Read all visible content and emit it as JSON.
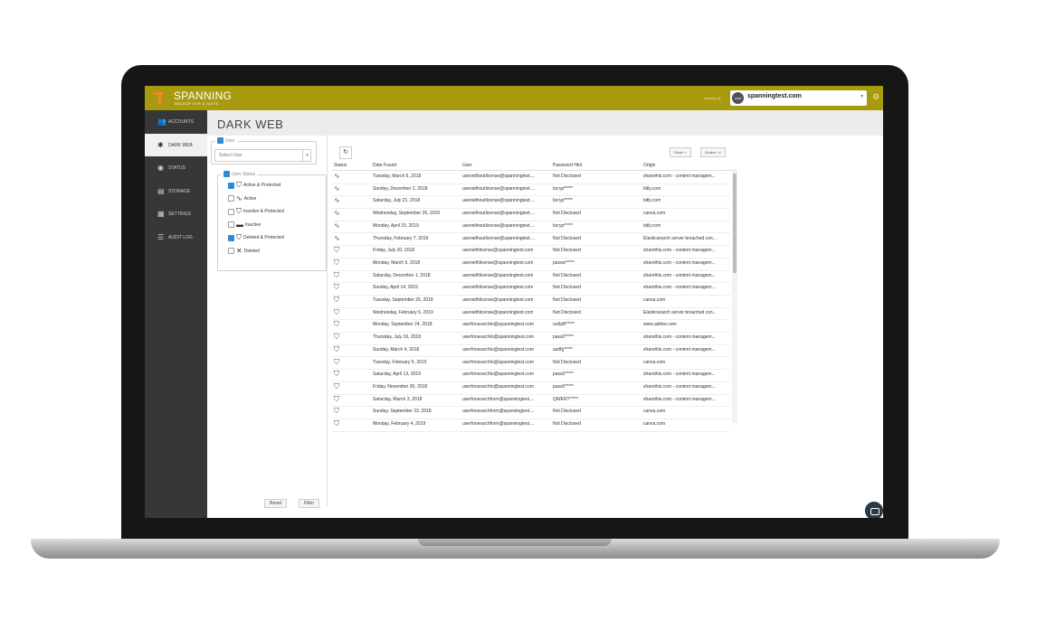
{
  "app": {
    "brand": "SPANNING",
    "brand_sub": "BACKUP FOR G SUITE",
    "view_as": "viewing as",
    "domain": "spanningtest.com",
    "domain_avatar": "com"
  },
  "sidebar": {
    "items": [
      {
        "label": "ACCOUNTS",
        "icon": "users-icon",
        "glyph": "👥",
        "active": false
      },
      {
        "label": "DARK WEB",
        "icon": "spider-icon",
        "glyph": "✱",
        "active": true
      },
      {
        "label": "STATUS",
        "icon": "status-icon",
        "glyph": "◉",
        "active": false
      },
      {
        "label": "STORAGE",
        "icon": "storage-icon",
        "glyph": "▤",
        "active": false
      },
      {
        "label": "SETTINGS",
        "icon": "settings-icon",
        "glyph": "▦",
        "active": false
      },
      {
        "label": "AUDIT LOG",
        "icon": "list-icon",
        "glyph": "☰",
        "active": false
      }
    ]
  },
  "page": {
    "title": "DARK WEB"
  },
  "filters": {
    "user_legend": "User",
    "user_placeholder": "Select User",
    "status_legend": "User Status",
    "statuses": [
      {
        "label": "Active & Protected",
        "checked": true,
        "glyph": "⛉"
      },
      {
        "label": "Active",
        "checked": false,
        "glyph": "∿"
      },
      {
        "label": "Inactive & Protected",
        "checked": false,
        "glyph": "⛉"
      },
      {
        "label": "Inactive",
        "checked": false,
        "glyph": "▬"
      },
      {
        "label": "Deleted & Protected",
        "checked": true,
        "glyph": "⛉"
      },
      {
        "label": "Deleted",
        "checked": false,
        "glyph": "✕"
      }
    ],
    "reset_label": "Reset",
    "filter_label": "Filter"
  },
  "toolbar": {
    "refresh_glyph": "↻",
    "order_prev": "Order <",
    "order_next": "Orders >>"
  },
  "table": {
    "headers": [
      "Status",
      "Date Found",
      "User",
      "Password Hint",
      "Origin"
    ],
    "rows": [
      {
        "status": "active",
        "date": "Tuesday, March 6, 2018",
        "user": "userwithoutlicense@spanningtest....",
        "hint": "Not Disclosed",
        "origin": "sharethis.com - content managem..."
      },
      {
        "status": "active",
        "date": "Sunday, December 2, 2018",
        "user": "userwithoutlicense@spanningtest....",
        "hint": "bcryp*****",
        "origin": "bitly.com"
      },
      {
        "status": "active",
        "date": "Saturday, July 21, 2018",
        "user": "userwithoutlicense@spanningtest....",
        "hint": "bcryp*****",
        "origin": "bitly.com"
      },
      {
        "status": "active",
        "date": "Wednesday, September 26, 2018",
        "user": "userwithoutlicense@spanningtest....",
        "hint": "Not Disclosed",
        "origin": "canva.com"
      },
      {
        "status": "active",
        "date": "Monday, April 15, 2019",
        "user": "userwithoutlicense@spanningtest....",
        "hint": "bcryp*****",
        "origin": "bitly.com"
      },
      {
        "status": "active",
        "date": "Thursday, February 7, 2019",
        "user": "userwithoutlicense@spanningtest....",
        "hint": "Not Disclosed",
        "origin": "Elasticsearch server breached con..."
      },
      {
        "status": "protected",
        "date": "Friday, July 20, 2018",
        "user": "userwithlicense@spanningtest.com",
        "hint": "Not Disclosed",
        "origin": "sharethis.com - content managem..."
      },
      {
        "status": "protected",
        "date": "Monday, March 5, 2018",
        "user": "userwithlicense@spanningtest.com",
        "hint": "passw*****",
        "origin": "sharethis.com - content managem..."
      },
      {
        "status": "protected",
        "date": "Saturday, December 1, 2018",
        "user": "userwithlicense@spanningtest.com",
        "hint": "Not Disclosed",
        "origin": "sharethis.com - content managem..."
      },
      {
        "status": "protected",
        "date": "Sunday, April 14, 2019",
        "user": "userwithlicense@spanningtest.com",
        "hint": "Not Disclosed",
        "origin": "sharethis.com - content managem..."
      },
      {
        "status": "protected",
        "date": "Tuesday, September 25, 2018",
        "user": "userwithlicense@spanningtest.com",
        "hint": "Not Disclosed",
        "origin": "canva.com"
      },
      {
        "status": "protected",
        "date": "Wednesday, February 6, 2019",
        "user": "userwithlicense@spanningtest.com",
        "hint": "Not Disclosed",
        "origin": "Elasticsearch server breached con..."
      },
      {
        "status": "protected",
        "date": "Monday, September 24, 2018",
        "user": "userforsearchto@spanningtest.com",
        "hint": "ou9pB*****",
        "origin": "www.adobe.com"
      },
      {
        "status": "protected",
        "date": "Thursday, July 19, 2018",
        "user": "userforsearchto@spanningtest.com",
        "hint": "pass0*****",
        "origin": "sharethis.com - content managem..."
      },
      {
        "status": "protected",
        "date": "Sunday, March 4, 2018",
        "user": "userforsearchto@spanningtest.com",
        "hint": "asdfg*****",
        "origin": "sharethis.com - content managem..."
      },
      {
        "status": "protected",
        "date": "Tuesday, February 5, 2019",
        "user": "userforsearchto@spanningtest.com",
        "hint": "Not Disclosed",
        "origin": "canva.com"
      },
      {
        "status": "protected",
        "date": "Saturday, April 13, 2019",
        "user": "userforsearchto@spanningtest.com",
        "hint": "pass0*****",
        "origin": "sharethis.com - content managem..."
      },
      {
        "status": "protected",
        "date": "Friday, November 30, 2018",
        "user": "userforsearchto@spanningtest.com",
        "hint": "pass0*****",
        "origin": "sharethis.com - content managem..."
      },
      {
        "status": "protected",
        "date": "Saturday, March 3, 2018",
        "user": "userforsearchfrom@spanningtest....",
        "hint": "QWERT*****",
        "origin": "sharethis.com - content managem..."
      },
      {
        "status": "protected",
        "date": "Sunday, September 23, 2018",
        "user": "userforsearchfrom@spanningtest....",
        "hint": "Not Disclosed",
        "origin": "canva.com"
      },
      {
        "status": "protected",
        "date": "Monday, February 4, 2019",
        "user": "userforsearchfrom@spanningtest....",
        "hint": "Not Disclosed",
        "origin": "canva.com"
      }
    ]
  },
  "colors": {
    "header": "#a79a0e",
    "logo_accent": "#f28c1c",
    "sidebar": "#373737",
    "checkbox": "#2e8bd8"
  }
}
